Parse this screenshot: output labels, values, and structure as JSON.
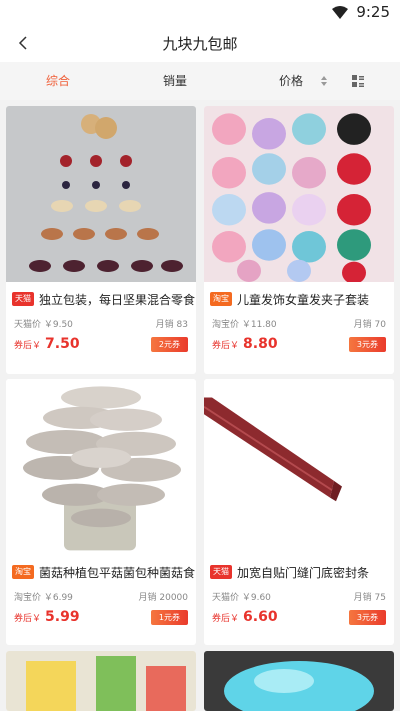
{
  "status": {
    "time": "9:25"
  },
  "nav": {
    "title": "九块九包邮"
  },
  "sort": [
    "综合",
    "销量",
    "价格"
  ],
  "products": [
    {
      "platform_tag": "天猫",
      "tag_kind": "tmall",
      "name": "独立包装，每日坚果混合零食!",
      "orig_label": "天猫价 ￥9.50",
      "sales": "月销 83",
      "after_label": "券后￥",
      "price": "7.50",
      "coupon": "2元券"
    },
    {
      "platform_tag": "淘宝",
      "tag_kind": "taobao",
      "name": "儿童发饰女童发夹子套装",
      "orig_label": "淘宝价 ￥11.80",
      "sales": "月销 70",
      "after_label": "券后￥",
      "price": "8.80",
      "coupon": "3元券"
    },
    {
      "platform_tag": "淘宝",
      "tag_kind": "taobao",
      "name": "菌菇种植包平菇菌包种菌菇食...",
      "orig_label": "淘宝价 ￥6.99",
      "sales": "月销 20000",
      "after_label": "券后￥",
      "price": "5.99",
      "coupon": "1元券"
    },
    {
      "platform_tag": "天猫",
      "tag_kind": "tmall",
      "name": "加宽自贴门缝门底密封条",
      "orig_label": "天猫价 ￥9.60",
      "sales": "月销 75",
      "after_label": "券后￥",
      "price": "6.60",
      "coupon": "3元券"
    }
  ]
}
